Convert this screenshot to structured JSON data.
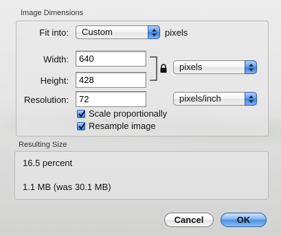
{
  "image_dimensions": {
    "title": "Image Dimensions",
    "fit_into": {
      "label": "Fit into:",
      "value": "Custom",
      "unit": "pixels"
    },
    "width": {
      "label": "Width:",
      "value": "640"
    },
    "height": {
      "label": "Height:",
      "value": "428"
    },
    "size_unit": "pixels",
    "resolution": {
      "label": "Resolution:",
      "value": "72",
      "unit": "pixels/inch"
    },
    "scale_proportionally": {
      "label": "Scale proportionally",
      "checked": true
    },
    "resample_image": {
      "label": "Resample image",
      "checked": true
    }
  },
  "resulting_size": {
    "title": "Resulting Size",
    "percent": "16.5 percent",
    "file_size": "1.1 MB (was 30.1 MB)"
  },
  "buttons": {
    "cancel": "Cancel",
    "ok": "OK"
  },
  "colors": {
    "accent_blue": "#4d8fe0",
    "sheet_gray": "#e8e8e8"
  }
}
